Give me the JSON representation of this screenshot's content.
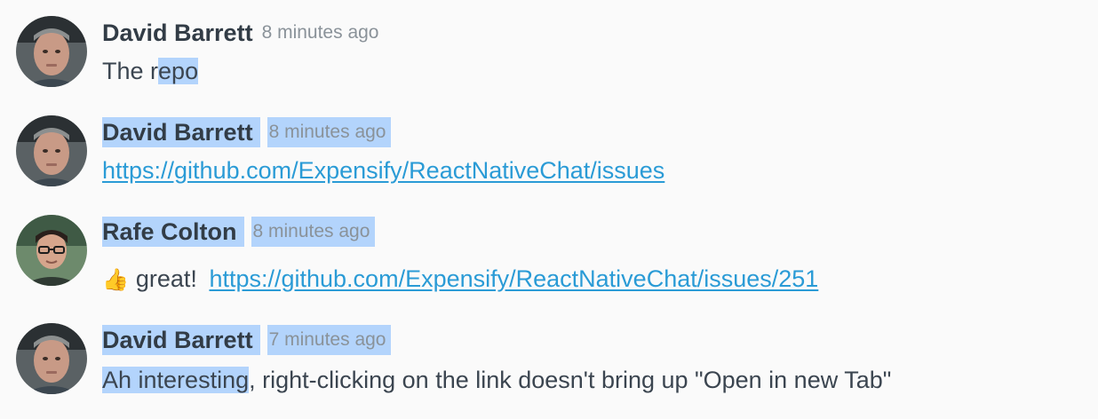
{
  "messages": [
    {
      "author": "David Barrett",
      "time": "8 minutes ago",
      "text_plain": "The r",
      "text_selected": "epo"
    },
    {
      "author": "David Barrett",
      "time": "8 minutes ago",
      "link": "https://github.com/Expensify/ReactNativeChat/issues"
    },
    {
      "author": "Rafe Colton",
      "time": "8 minutes ago",
      "emoji": "👍",
      "text": "great!",
      "link": "https://github.com/Expensify/ReactNativeChat/issues/251"
    },
    {
      "author": "David Barrett",
      "time": "7 minutes ago",
      "text_selected": "Ah interesting",
      "text_rest": ", right-clicking on the link doesn't bring up \"Open in new Tab\""
    }
  ],
  "colors": {
    "background": "#fafafa",
    "selection": "#b3d4fc",
    "link": "#2a9bd6",
    "author": "#323c46",
    "timestamp": "#8a9299"
  },
  "icons": {
    "avatar_david": "avatar-david-barrett",
    "avatar_rafe": "avatar-rafe-colton",
    "thumbs_up": "thumbs-up-emoji"
  }
}
